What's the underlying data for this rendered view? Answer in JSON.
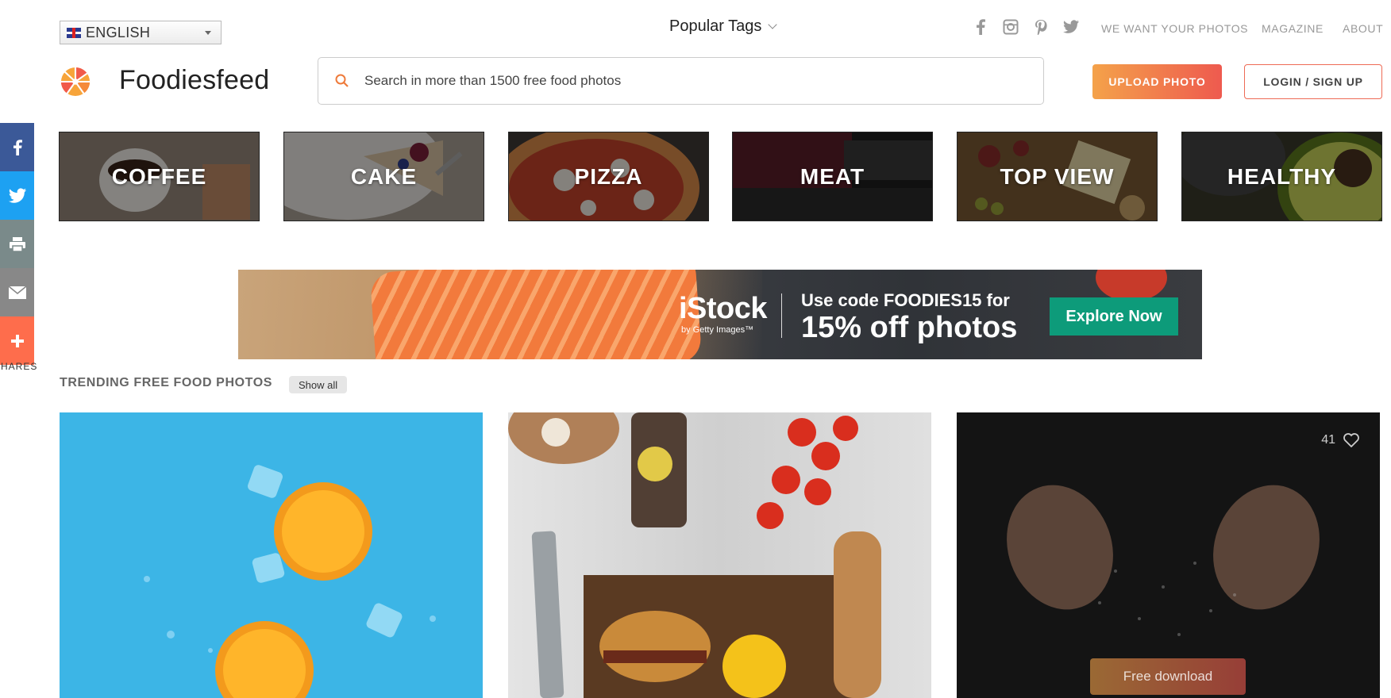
{
  "language": {
    "selected": "ENGLISH"
  },
  "popular_tags": {
    "label": "Popular Tags"
  },
  "top_links": [
    "WE WANT YOUR PHOTOS",
    "MAGAZINE",
    "ABOUT"
  ],
  "brand": {
    "name": "Foodiesfeed"
  },
  "search": {
    "placeholder": "Search in more than 1500 free food photos"
  },
  "buttons": {
    "upload": "UPLOAD PHOTO",
    "login": "LOGIN / SIGN UP"
  },
  "share": {
    "label": "SHARES",
    "colors": [
      "#3b5998",
      "#1da1f2",
      "#7a8a8a",
      "#888888",
      "#fe6d4c"
    ]
  },
  "categories": [
    {
      "label": "COFFEE",
      "color": "#6b5a4a"
    },
    {
      "label": "CAKE",
      "color": "#9a8f86"
    },
    {
      "label": "PIZZA",
      "color": "#8b5a3c"
    },
    {
      "label": "MEAT",
      "color": "#3a2224"
    },
    {
      "label": "TOP VIEW",
      "color": "#6d5534"
    },
    {
      "label": "HEALTHY",
      "color": "#5c6a2a"
    }
  ],
  "ad": {
    "brand": "iStock",
    "sub": "by Getty Images™",
    "code_line": "Use code FOODIES15 for",
    "offer_line": "15% off photos",
    "cta": "Explore Now"
  },
  "trending": {
    "title": "TRENDING FREE FOOD PHOTOS",
    "show_all": "Show all",
    "photos": [
      {
        "subject": "oranges and ice on blue"
      },
      {
        "subject": "burger, cola, tomatoes"
      },
      {
        "subject": "hands and flour",
        "likes": "41",
        "download": "Free download"
      }
    ]
  }
}
